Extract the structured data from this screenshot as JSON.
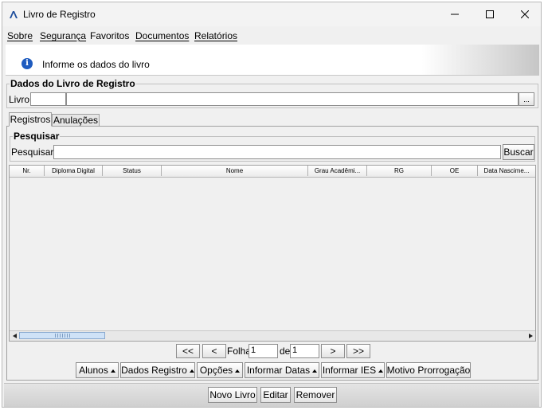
{
  "window": {
    "title": "Livro de Registro"
  },
  "menu": [
    "Sobre",
    "Segurança",
    "Favoritos",
    "Documentos",
    "Relatórios"
  ],
  "banner": {
    "text": "Informe os dados do livro"
  },
  "livro_group": {
    "title": "Dados do Livro de Registro",
    "label": "Livro:",
    "code_value": "",
    "name_value": "",
    "browse_label": "..."
  },
  "tabs": [
    "Registros",
    "Anulações"
  ],
  "search": {
    "title": "Pesquisar",
    "label": "Pesquisar:",
    "value": "",
    "button": "Buscar"
  },
  "table": {
    "columns": [
      "Nr.",
      "Diploma Digital",
      "Status",
      "Nome",
      "Grau Acadêmi...",
      "RG",
      "OE",
      "Data Nascime..."
    ],
    "rows": []
  },
  "pagination": {
    "first": "<<",
    "prev": "<",
    "folha_label": "Folha",
    "page": "1",
    "de_label": "de",
    "total": "1",
    "next": ">",
    "last": ">>"
  },
  "action_buttons": [
    "Alunos",
    "Dados Registro",
    "Opções",
    "Informar Datas",
    "Informar IES"
  ],
  "prorrogacao_button": "Motivo Prorrogação",
  "footer_buttons": [
    "Novo Livro",
    "Editar",
    "Remover"
  ]
}
